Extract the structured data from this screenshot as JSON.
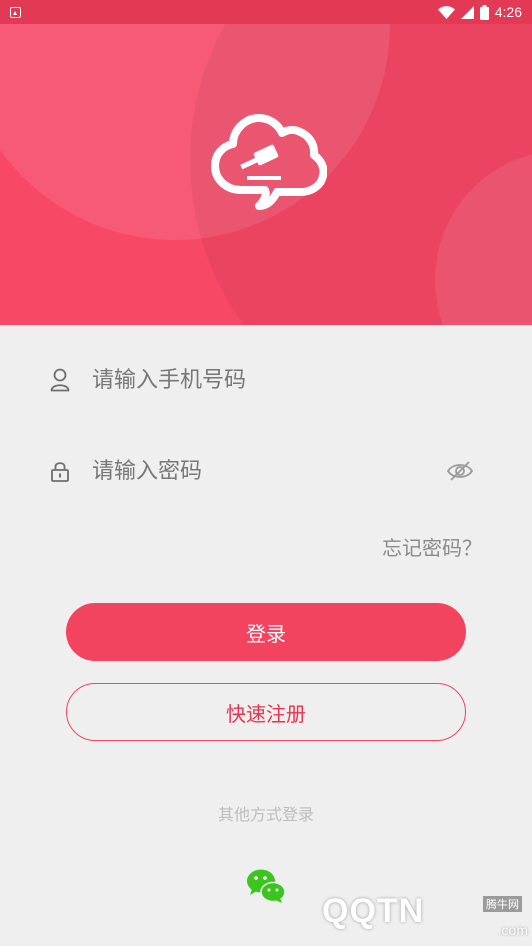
{
  "status_bar": {
    "time": "4:26",
    "icons": [
      "notification-icon",
      "wifi-icon",
      "signal-icon",
      "battery-icon"
    ]
  },
  "hero": {
    "background_color": "#f74866",
    "logo_icon": "cloud-gavel-icon"
  },
  "login_form": {
    "phone_placeholder": "请输入手机号码",
    "phone_value": "",
    "password_placeholder": "请输入密码",
    "password_value": "",
    "forgot_password": "忘记密码？"
  },
  "buttons": {
    "login": "登录",
    "register": "快速注册"
  },
  "other_login": {
    "label": "其他方式登录",
    "icon": "wechat-icon"
  },
  "watermark": {
    "logo": "QQTN",
    "site": "腾牛网",
    "suffix": ".com"
  },
  "colors": {
    "accent": "#f2435f",
    "background": "#efefef"
  }
}
